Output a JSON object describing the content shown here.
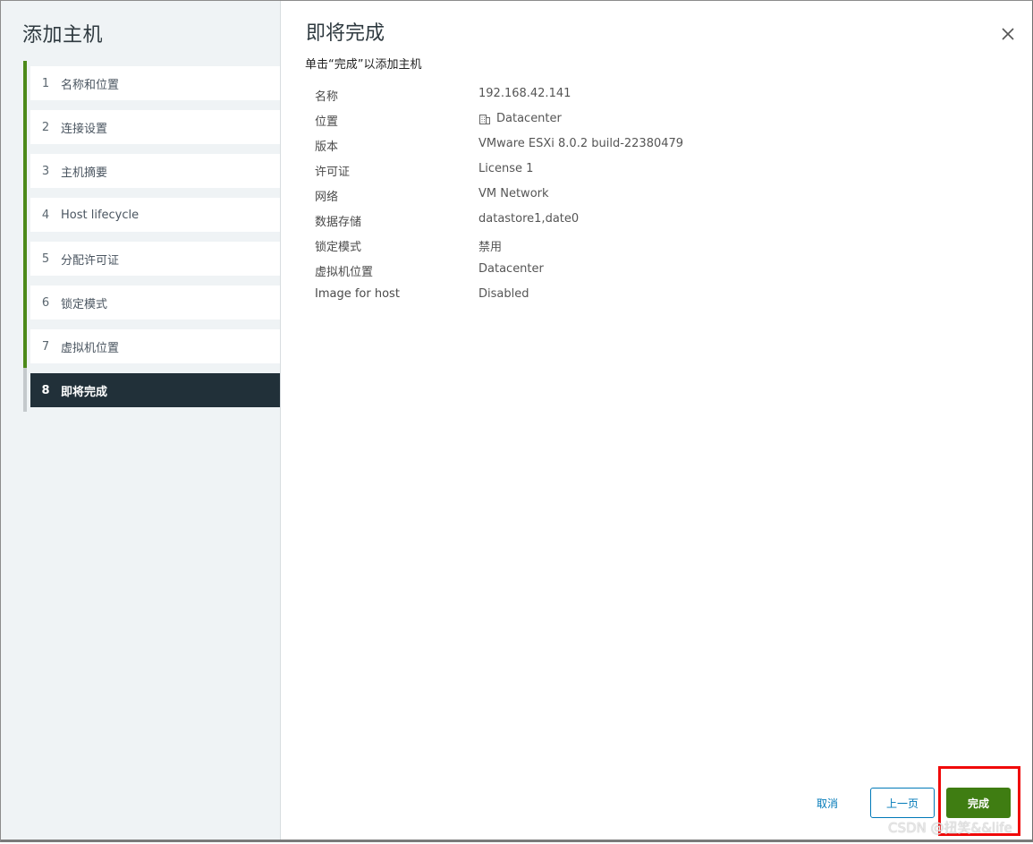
{
  "sidebar": {
    "title": "添加主机",
    "steps": [
      {
        "num": "1",
        "label": "名称和位置"
      },
      {
        "num": "2",
        "label": "连接设置"
      },
      {
        "num": "3",
        "label": "主机摘要"
      },
      {
        "num": "4",
        "label": "Host lifecycle"
      },
      {
        "num": "5",
        "label": "分配许可证"
      },
      {
        "num": "6",
        "label": "锁定模式"
      },
      {
        "num": "7",
        "label": "虚拟机位置"
      },
      {
        "num": "8",
        "label": "即将完成"
      }
    ]
  },
  "main": {
    "title": "即将完成",
    "subtitle": "单击“完成”以添加主机",
    "details": [
      {
        "key": "名称",
        "value": "192.168.42.141"
      },
      {
        "key": "位置",
        "value": "Datacenter",
        "icon": "datacenter-icon"
      },
      {
        "key": "版本",
        "value": "VMware ESXi 8.0.2 build-22380479"
      },
      {
        "key": "许可证",
        "value": "License 1"
      },
      {
        "key": "网络",
        "value": "VM Network"
      },
      {
        "key": "数据存储",
        "value": "datastore1,date0"
      },
      {
        "key": "锁定模式",
        "value": "禁用"
      },
      {
        "key": "虚拟机位置",
        "value": "Datacenter"
      },
      {
        "key": "Image for host",
        "value": "Disabled"
      }
    ]
  },
  "buttons": {
    "cancel": "取消",
    "back": "上一页",
    "finish": "完成"
  },
  "watermark": "CSDN @扭笑&&life",
  "colors": {
    "accent_green": "#3f7d12",
    "step_bar_green": "#4d8a1a",
    "link_blue": "#0079b8",
    "current_step_bg": "#213039",
    "highlight_red": "#f00a0a"
  }
}
